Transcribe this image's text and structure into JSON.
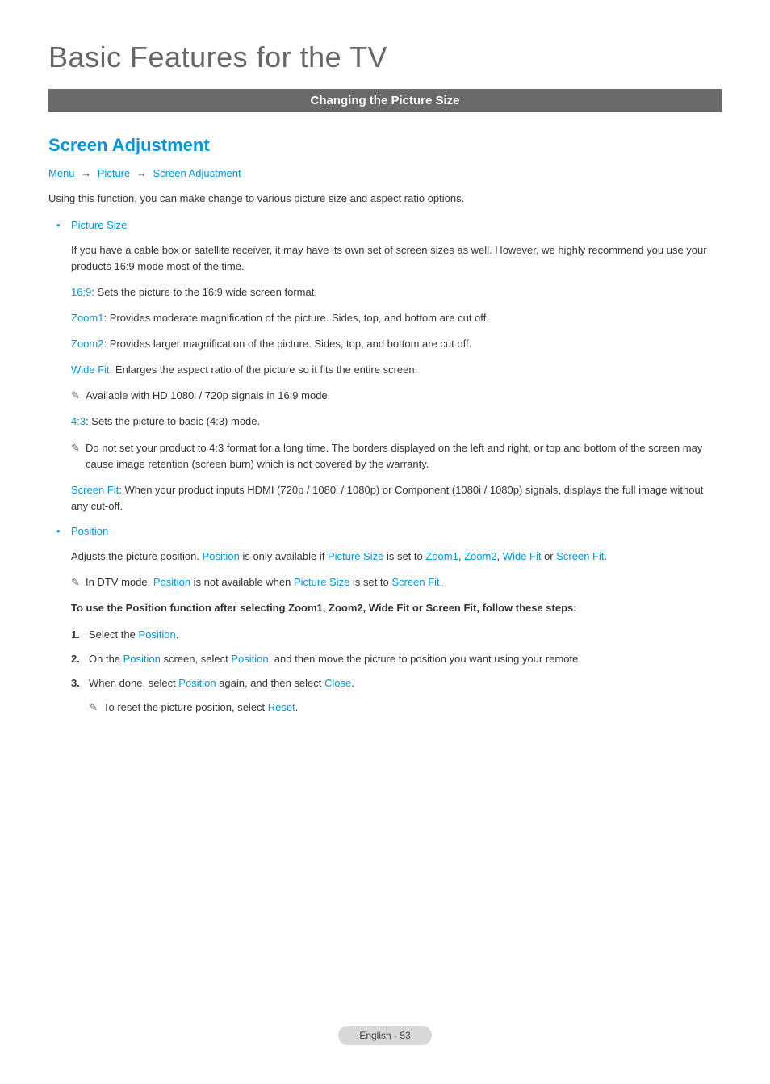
{
  "page": {
    "title": "Basic Features for the TV",
    "section_bar": "Changing the Picture Size",
    "heading": "Screen Adjustment",
    "breadcrumb": {
      "menu": "Menu",
      "picture": "Picture",
      "screen_adjustment": "Screen Adjustment"
    },
    "intro": "Using this function, you can make change to various picture size and aspect ratio options.",
    "bullets": {
      "picture_size": "Picture Size",
      "position": "Position"
    },
    "ps_intro": "If you have a cable box or satellite receiver, it may have its own set of screen sizes as well. However, we highly recommend you use your products 16:9 mode most of the time.",
    "ps_169_label": "16:9",
    "ps_169_text": ": Sets the picture to the 16:9 wide screen format.",
    "ps_zoom1_label": "Zoom1",
    "ps_zoom1_text": ": Provides moderate magnification of the picture. Sides, top, and bottom are cut off.",
    "ps_zoom2_label": "Zoom2",
    "ps_zoom2_text": ": Provides larger magnification of the picture. Sides, top, and bottom are cut off.",
    "ps_widefit_label": "Wide Fit",
    "ps_widefit_text": ": Enlarges the aspect ratio of the picture so it fits the entire screen.",
    "note_hd": "Available with HD 1080i / 720p signals in 16:9 mode.",
    "ps_43_label": "4:3",
    "ps_43_text": ": Sets the picture to basic (4:3) mode.",
    "note_43": "Do not set your product to 4:3 format for a long time. The borders displayed on the left and right, or top and bottom of the screen may cause image retention (screen burn) which is not covered by the warranty.",
    "ps_screenfit_label": "Screen Fit",
    "ps_screenfit_text": ": When your product inputs HDMI (720p / 1080i / 1080p) or Component (1080i / 1080p) signals, displays the full image without any cut-off.",
    "position_intro_pre": "Adjusts the picture position. ",
    "position_intro_p1": "Position",
    "position_intro_mid1": " is only available if ",
    "position_intro_p2": "Picture Size",
    "position_intro_mid2": " is set to ",
    "position_intro_z1": "Zoom1",
    "position_intro_c1": ", ",
    "position_intro_z2": "Zoom2",
    "position_intro_c2": ", ",
    "position_intro_wf": "Wide Fit",
    "position_intro_or": " or ",
    "position_intro_sf": "Screen Fit",
    "position_intro_end": ".",
    "note_dtv_pre": "In DTV mode, ",
    "note_dtv_pos": "Position",
    "note_dtv_mid": " is not available when ",
    "note_dtv_ps": "Picture Size",
    "note_dtv_mid2": " is set to ",
    "note_dtv_sf": "Screen Fit",
    "note_dtv_end": ".",
    "steps_heading": "To use the Position function after selecting Zoom1, Zoom2, Wide Fit or Screen Fit, follow these steps:",
    "step1_num": "1.",
    "step1_pre": "Select the ",
    "step1_pos": "Position",
    "step1_end": ".",
    "step2_num": "2.",
    "step2_pre": "On the ",
    "step2_pos1": "Position",
    "step2_mid1": " screen, select ",
    "step2_pos2": "Position",
    "step2_end": ", and then move the picture to position you want using your remote.",
    "step3_num": "3.",
    "step3_pre": "When done, select ",
    "step3_pos": "Position",
    "step3_mid": " again, and then select ",
    "step3_close": "Close",
    "step3_end": ".",
    "note_reset_pre": "To reset the picture position, select ",
    "note_reset_reset": "Reset",
    "note_reset_end": ".",
    "footer": "English - 53"
  }
}
